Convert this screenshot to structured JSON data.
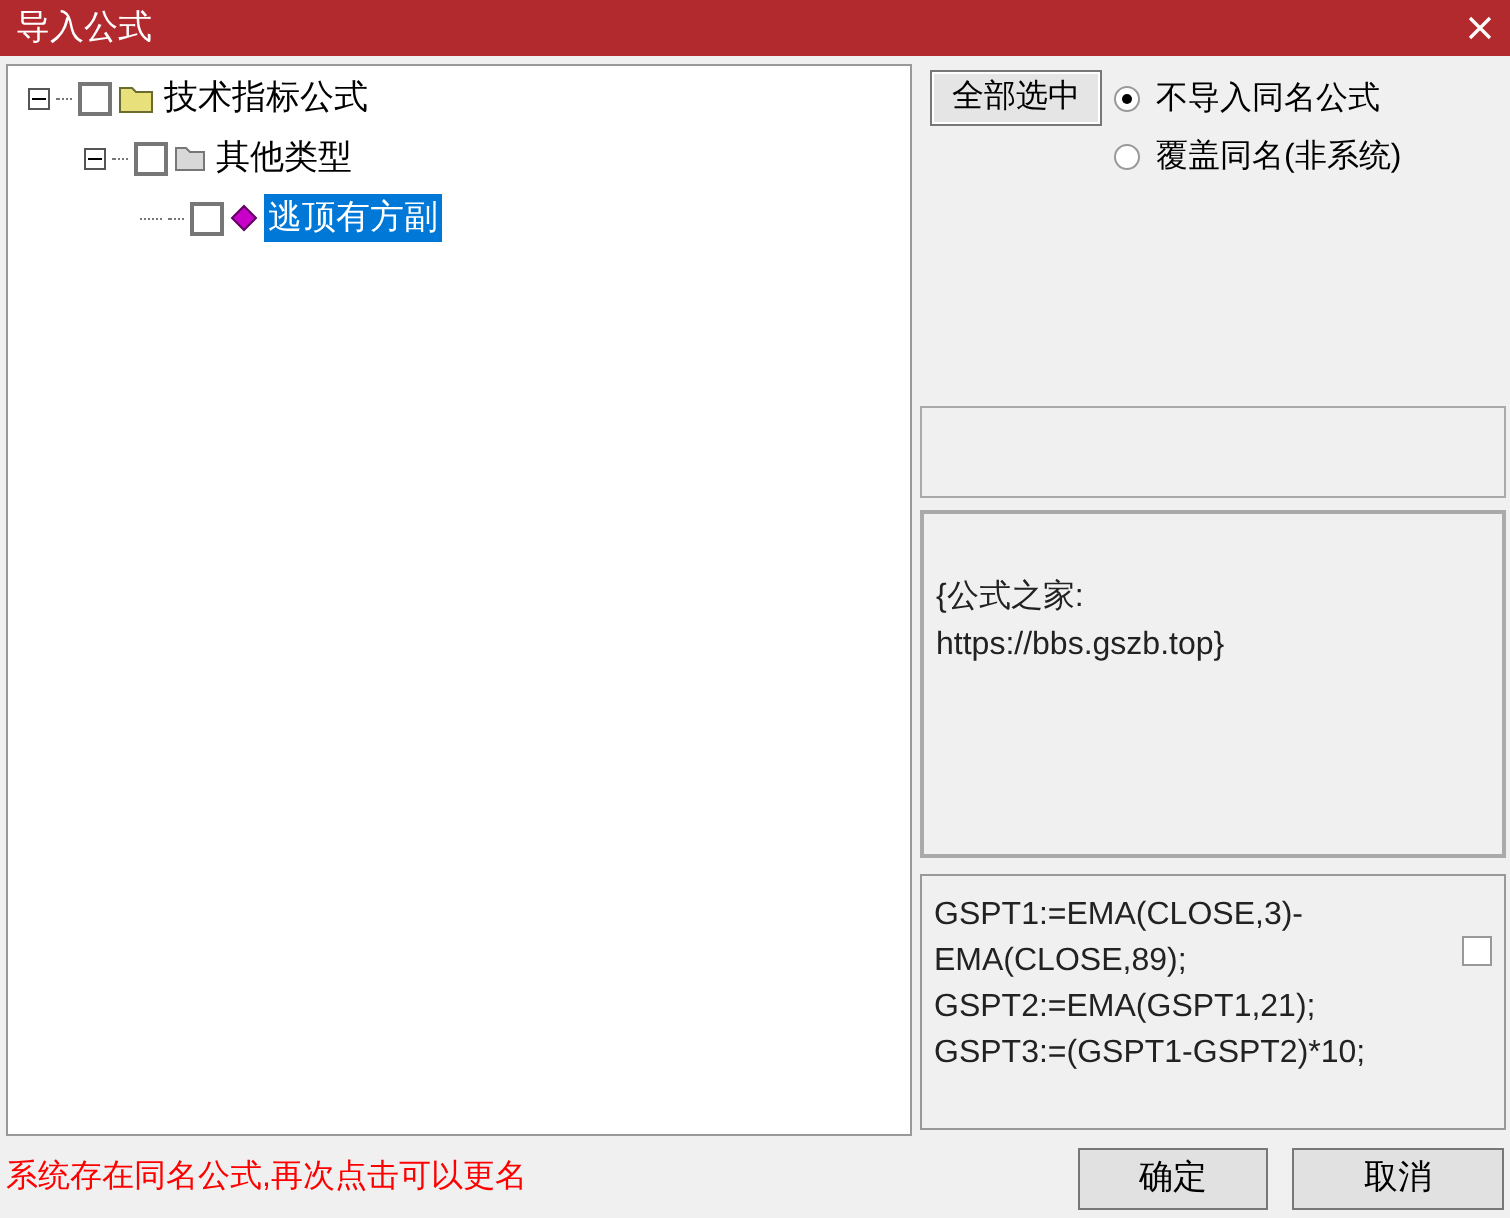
{
  "window": {
    "title": "导入公式"
  },
  "tree": [
    {
      "label": "技术指标公式",
      "kind": "folder",
      "expanded": true,
      "checked": false,
      "selected": false,
      "children": [
        {
          "label": "其他类型",
          "kind": "category",
          "expanded": true,
          "checked": false,
          "selected": false,
          "children": [
            {
              "label": "逃顶有方副",
              "kind": "formula",
              "checked": false,
              "selected": true
            }
          ]
        }
      ]
    }
  ],
  "select_all_button": "全部选中",
  "options": [
    {
      "label": "不导入同名公式",
      "selected": true
    },
    {
      "label": "覆盖同名(非系统)",
      "selected": false
    }
  ],
  "description": "{公式之家:\nhttps://bbs.gszb.top}",
  "formula": {
    "lines": [
      "GSPT1:=EMA(CLOSE,3)-",
      "EMA(CLOSE,89);",
      "GSPT2:=EMA(GSPT1,21);",
      "GSPT3:=(GSPT1-GSPT2)*10;"
    ],
    "checked": false
  },
  "status": "系统存在同名公式,再次点击可以更名",
  "buttons": [
    "确定",
    "取消"
  ]
}
